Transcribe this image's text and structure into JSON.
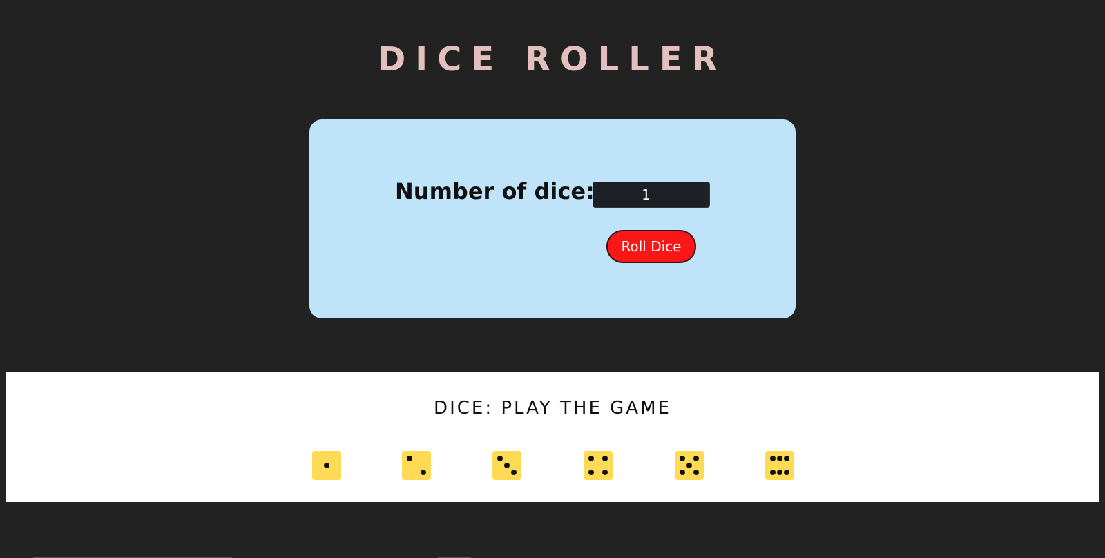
{
  "header": {
    "title": "DICE ROLLER",
    "title_color": "#e3bfbd"
  },
  "roller": {
    "label": "Number of dice:",
    "dice_count_value": "1",
    "roll_button_label": "Roll Dice",
    "panel_color": "#bfe3f9",
    "button_color": "#fb1618"
  },
  "game": {
    "heading": "DICE: PLAY THE GAME",
    "dice_faces": [
      1,
      2,
      3,
      4,
      5,
      6
    ],
    "die_color": "#ffdb55"
  },
  "colors": {
    "background": "#222222"
  }
}
